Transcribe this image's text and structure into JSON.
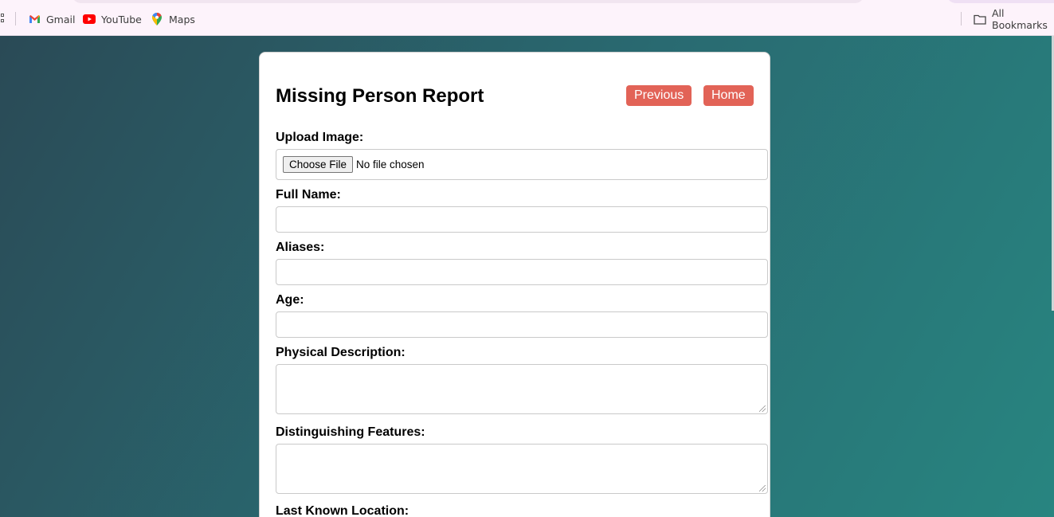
{
  "bookmarks_bar": {
    "items": [
      {
        "label": "Gmail",
        "icon": "gmail-icon"
      },
      {
        "label": "YouTube",
        "icon": "youtube-icon"
      },
      {
        "label": "Maps",
        "icon": "maps-icon"
      }
    ],
    "all_bookmarks": "All Bookmarks"
  },
  "form": {
    "title": "Missing Person Report",
    "previous_label": "Previous",
    "home_label": "Home",
    "upload_label": "Upload Image:",
    "choose_file_label": "Choose File",
    "file_status": "No file chosen",
    "full_name_label": "Full Name:",
    "aliases_label": "Aliases:",
    "age_label": "Age:",
    "physical_description_label": "Physical Description:",
    "distinguishing_features_label": "Distinguishing Features:",
    "last_known_location_label": "Last Known Location:"
  },
  "colors": {
    "accent_button": "#e26357",
    "background_start": "#2a4a56",
    "background_end": "#288580"
  }
}
